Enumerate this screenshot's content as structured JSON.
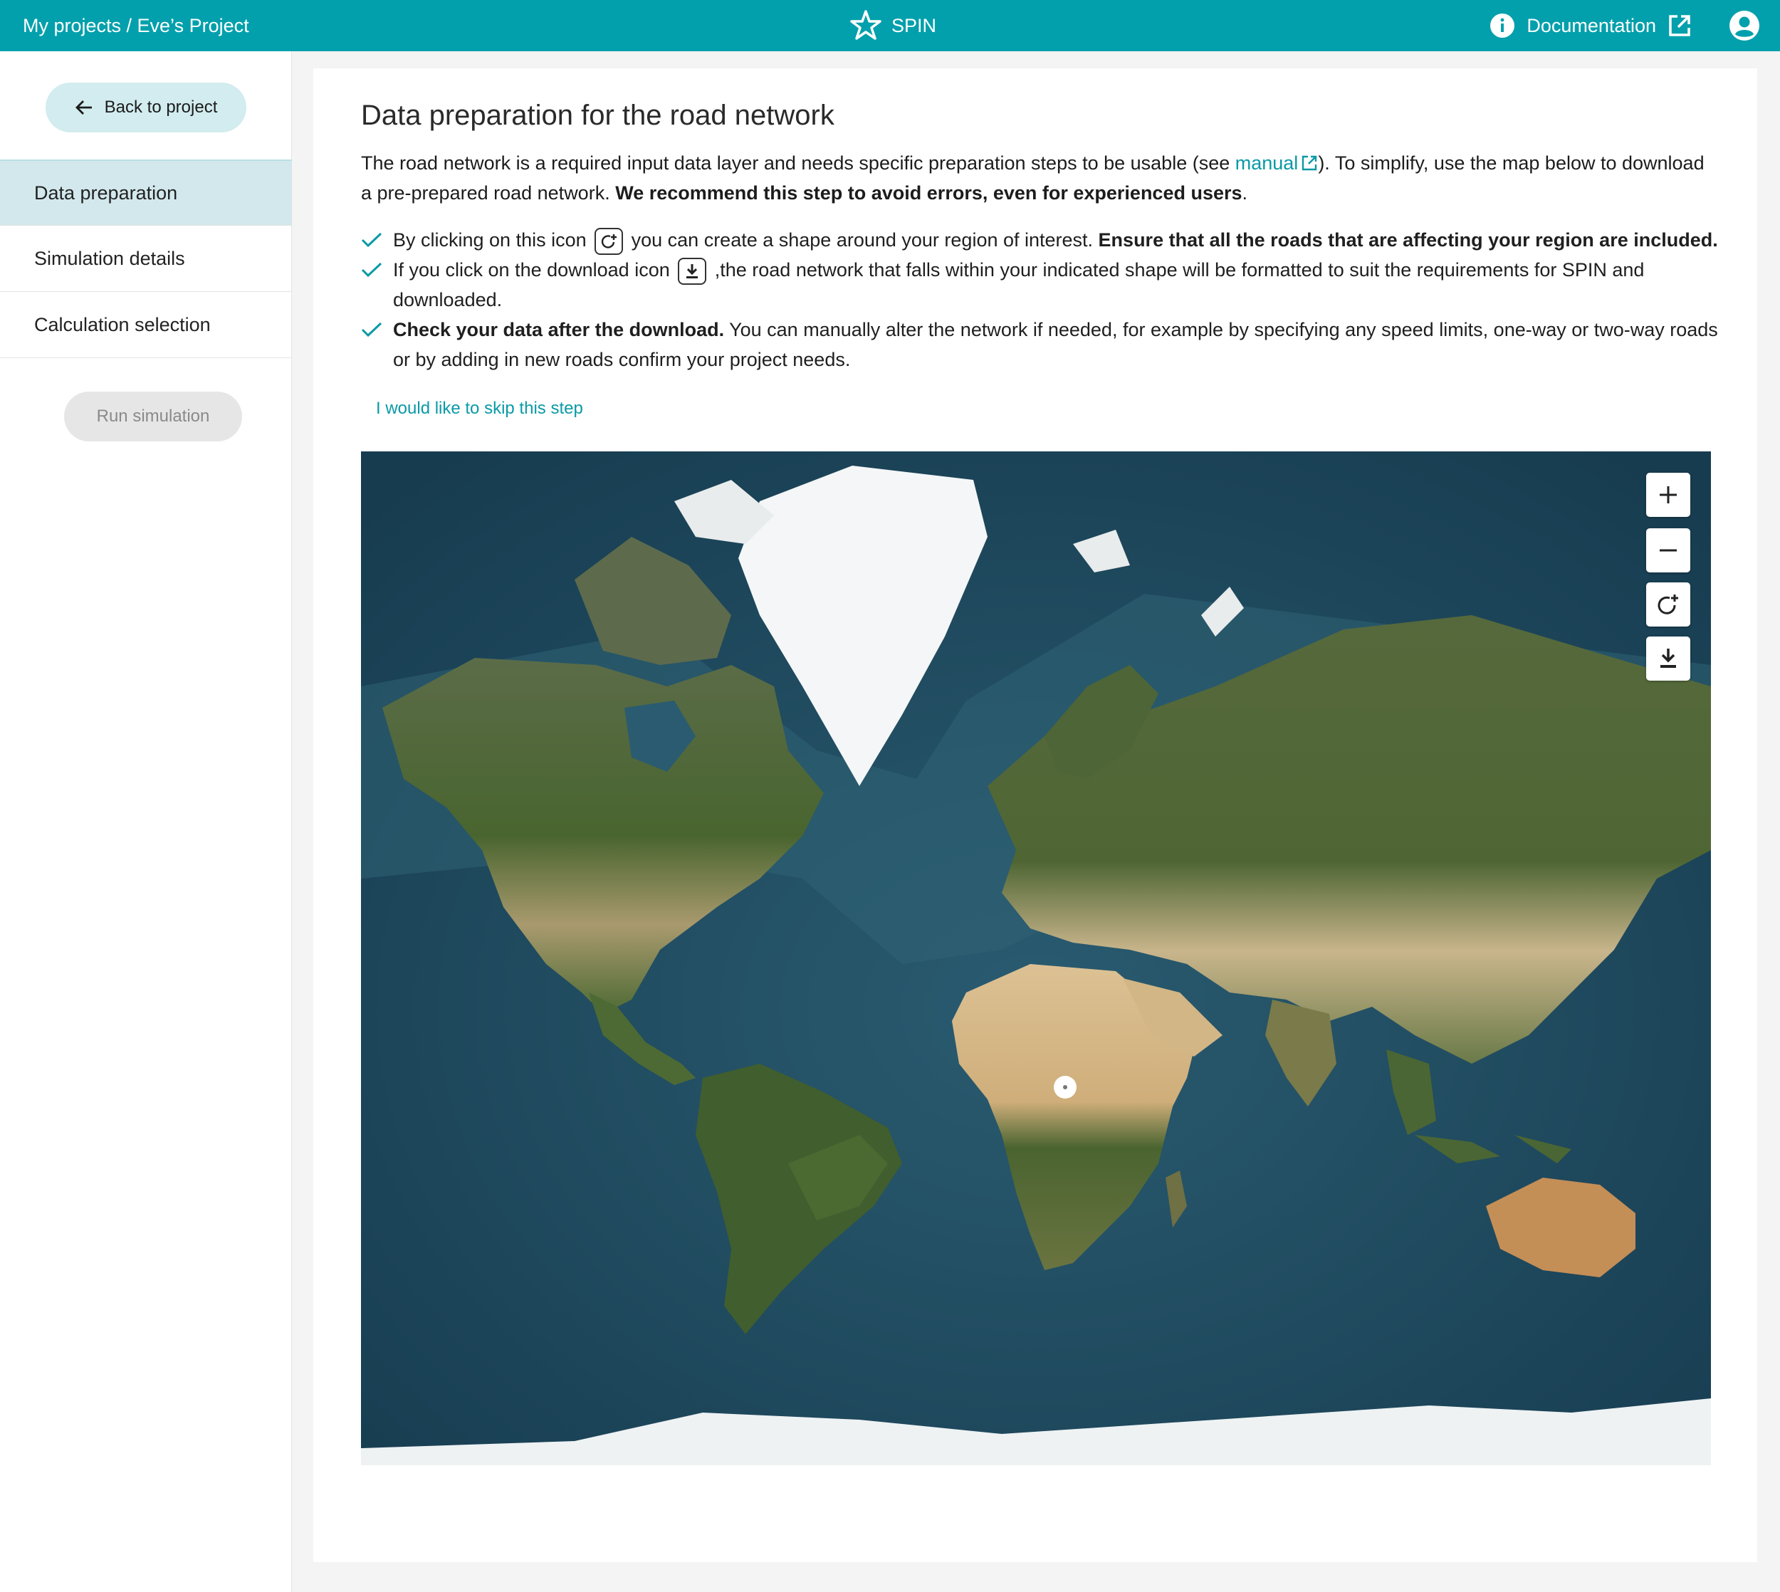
{
  "topbar": {
    "breadcrumb": "My projects / Eve’s Project",
    "brand": "SPIN",
    "documentation": "Documentation"
  },
  "sidebar": {
    "back_label": "Back to project",
    "items": [
      {
        "label": "Data preparation",
        "active": true
      },
      {
        "label": "Simulation details",
        "active": false
      },
      {
        "label": "Calculation selection",
        "active": false
      }
    ],
    "run_label": "Run simulation"
  },
  "main": {
    "title": "Data preparation for the road network",
    "intro": {
      "part1": "The road network is a required input data layer and needs specific preparation steps to be usable (see ",
      "manual_link": "manual",
      "part2": "). To simplify, use the map below to download a pre-prepared road network. ",
      "bold": "We recommend this step to avoid errors, even for experienced users",
      "end": "."
    },
    "checks": [
      {
        "before": "By clicking on this icon ",
        "after": " you can create a shape around your region of interest. ",
        "bold": "Ensure that all the roads that are affecting your region are included."
      },
      {
        "before": "If you click on the download icon ",
        "after": " ,the road network that falls within your indicated shape will be formatted to suit the requirements for SPIN and downloaded."
      },
      {
        "bold": "Check your data after the download.",
        "after": " You can manually alter the network if needed, for example by specifying any speed limits, one-way or two-way roads or by adding in new roads confirm your project needs."
      }
    ],
    "skip_link": "I would like to skip this step"
  },
  "map": {
    "controls": [
      "zoom-in",
      "zoom-out",
      "draw-shape",
      "download"
    ],
    "colors": {
      "ocean": "#1e4e64",
      "land_green": "#4d6a34",
      "desert": "#d6b987",
      "ice": "#f4f6f7",
      "accent": "#02a0ac"
    }
  }
}
